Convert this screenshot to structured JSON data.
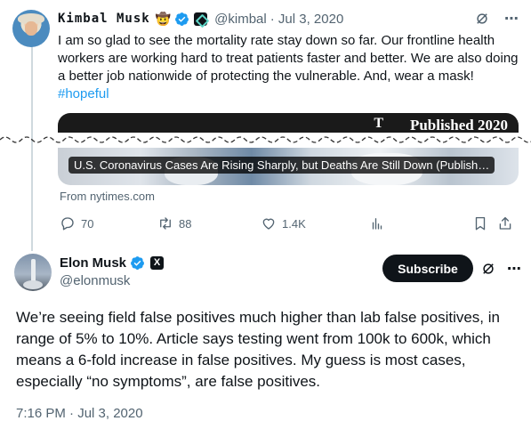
{
  "tweet1": {
    "name": "Kimbal Musk",
    "emoji": "🤠",
    "handle": "@kimbal",
    "date": "· Jul 3, 2020",
    "text": "I am so glad to see the mortality rate stay down so far. Our frontline health workers are working hard to treat patients faster and better. We are also doing a better job nationwide of protecting the vulnerable. And, wear a mask! ",
    "hashtag": "#hopeful",
    "card": {
      "image_overlay": "Published 2020",
      "logo_text": "T",
      "caption": "U.S. Coronavirus Cases Are Rising Sharply, but Deaths Are Still Down (Publish…",
      "source": "From nytimes.com"
    },
    "actions": {
      "replies": "70",
      "retweets": "88",
      "likes": "1.4K"
    }
  },
  "tweet2": {
    "name": "Elon Musk",
    "handle": "@elonmusk",
    "subscribe_label": "Subscribe",
    "text": "We’re seeing field false positives much higher than lab false positives, in range of 5% to 10%. Article says testing went from 100k to 600k, which means a 6-fold increase in false positives. My guess is most cases, especially “no symptoms”, are false positives.",
    "timestamp": "7:16 PM · Jul 3, 2020",
    "x_badge": "X"
  },
  "icons": {
    "more": "⋯"
  },
  "colors": {
    "link": "#1d9bf0",
    "secondary_text": "#536471",
    "primary_text": "#0f1419",
    "verified": "#1d9bf0"
  }
}
